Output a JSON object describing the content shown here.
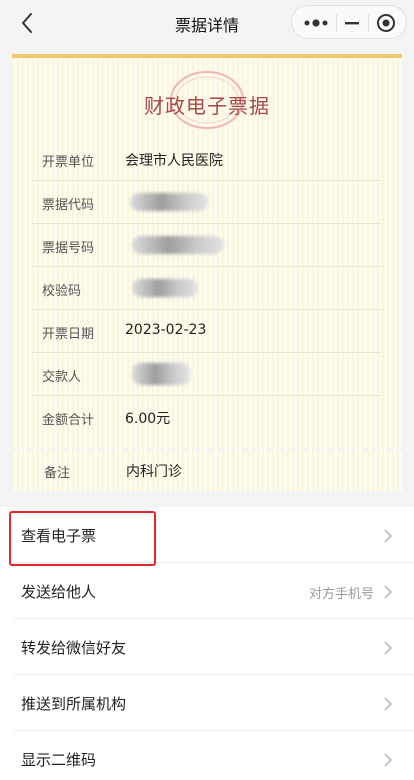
{
  "nav": {
    "title": "票据详情"
  },
  "receipt": {
    "title": "财政电子票据",
    "fields": [
      {
        "label": "开票单位",
        "value": "会理市人民医院"
      },
      {
        "label": "票据代码",
        "value": ""
      },
      {
        "label": "票据号码",
        "value": ""
      },
      {
        "label": "校验码",
        "value": ""
      },
      {
        "label": "开票日期",
        "value": "2023-02-23"
      },
      {
        "label": "交款人",
        "value": ""
      },
      {
        "label": "金额合计",
        "value": "6.00元"
      }
    ],
    "remark": {
      "label": "备注",
      "value": "内科门诊"
    }
  },
  "actions": [
    {
      "label": "查看电子票",
      "hint": ""
    },
    {
      "label": "发送给他人",
      "hint": "对方手机号"
    },
    {
      "label": "转发给微信好友",
      "hint": ""
    },
    {
      "label": "推送到所属机构",
      "hint": ""
    },
    {
      "label": "显示二维码",
      "hint": ""
    }
  ],
  "icons": {
    "back": "chevron-left-icon",
    "more": "more-dots-icon",
    "minimize": "minimize-icon",
    "close": "target-close-icon",
    "item_arrow": "chevron-right-icon"
  },
  "colors": {
    "receipt_title": "#a84848",
    "receipt_border": "#f0c76c",
    "highlight": "#e8262d"
  }
}
